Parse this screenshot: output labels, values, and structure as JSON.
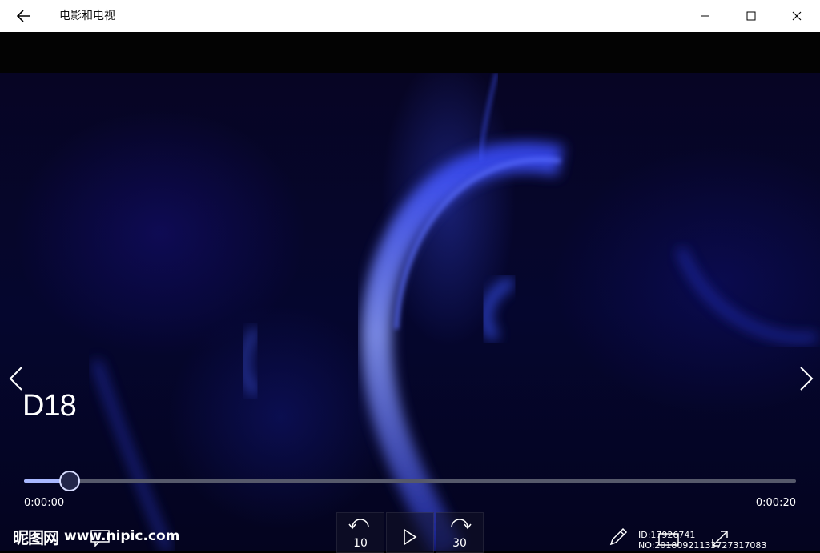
{
  "window": {
    "title": "电影和电视",
    "buttons": {
      "back": "back-arrow-icon",
      "minimize": "minimize-icon",
      "maximize": "maximize-icon",
      "close": "close-icon"
    }
  },
  "player": {
    "media_title": "D18",
    "current_time": "0:00:00",
    "total_time": "0:00:20",
    "progress": 0.059,
    "skip_back_seconds": "10",
    "skip_forward_seconds": "30"
  },
  "watermark": {
    "logo_text": "昵图网",
    "url_text": "www.nipic.com",
    "id_text": "ID:17926741 NO:20180921133727317083"
  },
  "colors": {
    "titlebar_bg": "#ffffff",
    "seek_fill": "#a9b8ff",
    "seek_track": "#56596b",
    "video_glow": "#2f43ff"
  }
}
